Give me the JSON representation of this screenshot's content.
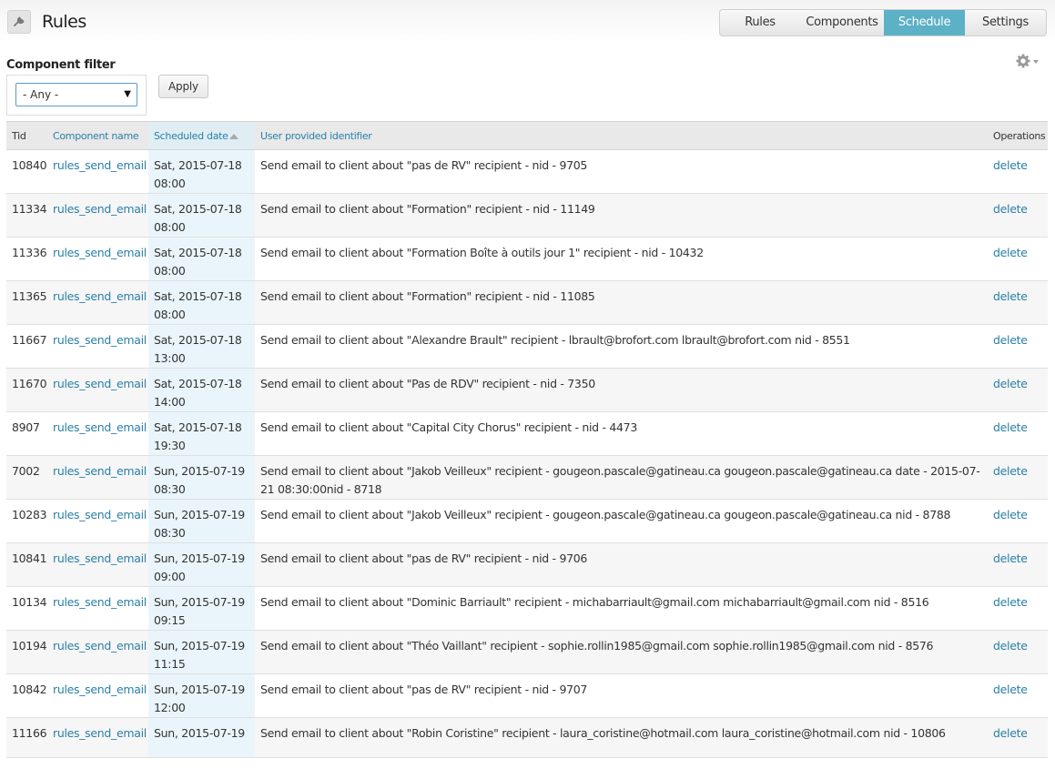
{
  "header": {
    "title": "Rules",
    "tabs": [
      {
        "label": "Rules",
        "active": false
      },
      {
        "label": "Components",
        "active": false
      },
      {
        "label": "Schedule",
        "active": true
      },
      {
        "label": "Settings",
        "active": false
      }
    ]
  },
  "filter": {
    "label": "Component filter",
    "select_value": "- Any -",
    "apply_label": "Apply"
  },
  "table": {
    "columns": [
      "Tid",
      "Component name",
      "Scheduled date",
      "User provided identifier",
      "Operations"
    ],
    "rows": [
      {
        "tid": "10840",
        "component": "rules_send_email",
        "date": "Sat, 2015-07-18",
        "time": "08:00",
        "identifier": "Send email to client about \"pas de RV\" recipient - nid - 9705",
        "op": "delete"
      },
      {
        "tid": "11334",
        "component": "rules_send_email",
        "date": "Sat, 2015-07-18",
        "time": "08:00",
        "identifier": "Send email to client about \"Formation\" recipient - nid - 11149",
        "op": "delete"
      },
      {
        "tid": "11336",
        "component": "rules_send_email",
        "date": "Sat, 2015-07-18",
        "time": "08:00",
        "identifier": "Send email to client about \"Formation Boîte à outils jour 1\" recipient - nid - 10432",
        "op": "delete"
      },
      {
        "tid": "11365",
        "component": "rules_send_email",
        "date": "Sat, 2015-07-18",
        "time": "08:00",
        "identifier": "Send email to client about \"Formation\" recipient - nid - 11085",
        "op": "delete"
      },
      {
        "tid": "11667",
        "component": "rules_send_email",
        "date": "Sat, 2015-07-18",
        "time": "13:00",
        "identifier": "Send email to client about \"Alexandre Brault\" recipient - lbrault@brofort.com lbrault@brofort.com nid - 8551",
        "op": "delete"
      },
      {
        "tid": "11670",
        "component": "rules_send_email",
        "date": "Sat, 2015-07-18",
        "time": "14:00",
        "identifier": "Send email to client about \"Pas de RDV\" recipient - nid - 7350",
        "op": "delete"
      },
      {
        "tid": "8907",
        "component": "rules_send_email",
        "date": "Sat, 2015-07-18",
        "time": "19:30",
        "identifier": "Send email to client about \"Capital City Chorus\" recipient - nid - 4473",
        "op": "delete"
      },
      {
        "tid": "7002",
        "component": "rules_send_email",
        "date": "Sun, 2015-07-19",
        "time": "08:30",
        "identifier": "Send email to client about \"Jakob Veilleux\" recipient - gougeon.pascale@gatineau.ca gougeon.pascale@gatineau.ca date - 2015-07-21 08:30:00nid - 8718",
        "op": "delete"
      },
      {
        "tid": "10283",
        "component": "rules_send_email",
        "date": "Sun, 2015-07-19",
        "time": "08:30",
        "identifier": "Send email to client about \"Jakob Veilleux\" recipient - gougeon.pascale@gatineau.ca gougeon.pascale@gatineau.ca nid - 8788",
        "op": "delete"
      },
      {
        "tid": "10841",
        "component": "rules_send_email",
        "date": "Sun, 2015-07-19",
        "time": "09:00",
        "identifier": "Send email to client about \"pas de RV\" recipient - nid - 9706",
        "op": "delete"
      },
      {
        "tid": "10134",
        "component": "rules_send_email",
        "date": "Sun, 2015-07-19",
        "time": "09:15",
        "identifier": "Send email to client about \"Dominic Barriault\" recipient - michabarriault@gmail.com michabarriault@gmail.com nid - 8516",
        "op": "delete"
      },
      {
        "tid": "10194",
        "component": "rules_send_email",
        "date": "Sun, 2015-07-19",
        "time": "11:15",
        "identifier": "Send email to client about \"Théo Vaillant\" recipient - sophie.rollin1985@gmail.com sophie.rollin1985@gmail.com nid - 8576",
        "op": "delete"
      },
      {
        "tid": "10842",
        "component": "rules_send_email",
        "date": "Sun, 2015-07-19",
        "time": "12:00",
        "identifier": "Send email to client about \"pas de RV\" recipient - nid - 9707",
        "op": "delete"
      },
      {
        "tid": "11166",
        "component": "rules_send_email",
        "date": "Sun, 2015-07-19",
        "time": "",
        "identifier": "Send email to client about \"Robin Coristine\" recipient - laura_coristine@hotmail.com laura_coristine@hotmail.com nid - 10806",
        "op": "delete"
      }
    ]
  },
  "icons": {
    "title": "wrench-icon",
    "gear": "gear-icon",
    "sort": "sort-asc-icon",
    "caret": "caret-down-icon"
  },
  "colors": {
    "accent": "#5cb1c6",
    "link": "#2a7fa8"
  }
}
